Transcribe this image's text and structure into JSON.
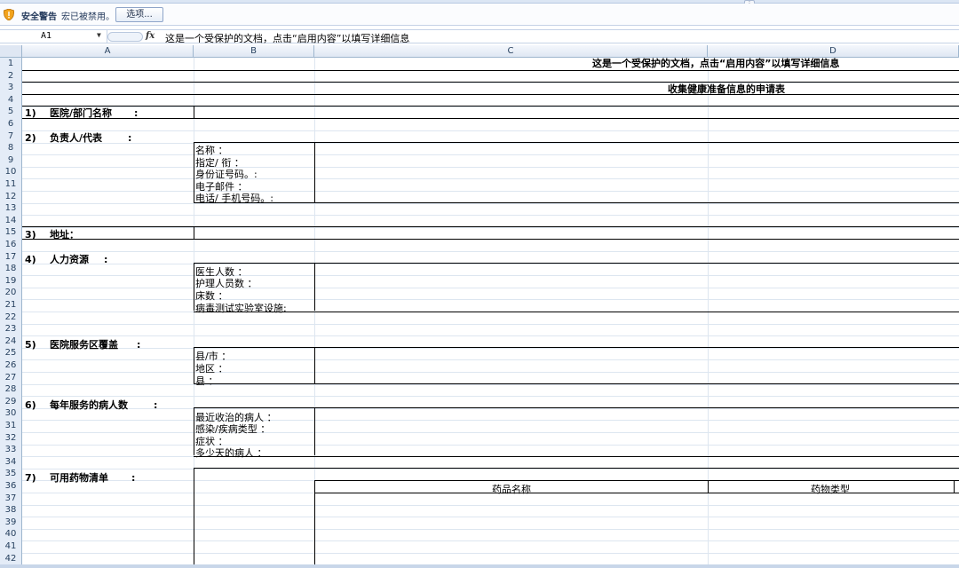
{
  "message_bar": {
    "title": "安全警告",
    "text": "宏已被禁用。",
    "options_button": "选项..."
  },
  "formula_bar": {
    "name_box": "A1",
    "fx": "fx",
    "content": "这是一个受保护的文档，点击“启用内容”以填写详细信息"
  },
  "columns": [
    "A",
    "B",
    "C",
    "D"
  ],
  "rows": [
    "1",
    "2",
    "3",
    "4",
    "5",
    "6",
    "7",
    "8",
    "9",
    "10",
    "11",
    "12",
    "13",
    "14",
    "15",
    "16",
    "17",
    "18",
    "19",
    "20",
    "21",
    "22",
    "23",
    "24",
    "25",
    "26",
    "27",
    "28",
    "29",
    "30",
    "31",
    "32",
    "33",
    "34",
    "35",
    "36",
    "37",
    "38",
    "39",
    "40",
    "41",
    "42"
  ],
  "sheet": {
    "notice": "这是一个受保护的文档，点击“启用内容”以填写详细信息",
    "form_title": "收集健康准备信息的申请表",
    "sections": [
      {
        "num": "1)",
        "label": "医院/部门名称",
        "colon": ":"
      },
      {
        "num": "2)",
        "label": "负责人/代表",
        "colon": ":"
      },
      {
        "num": "3)",
        "label": "地址：",
        "colon": ""
      },
      {
        "num": "4)",
        "label": "人力资源",
        "colon": ":"
      },
      {
        "num": "5)",
        "label": "医院服务区覆盖",
        "colon": ":"
      },
      {
        "num": "6)",
        "label": "每年服务的病人数",
        "colon": ":"
      },
      {
        "num": "7)",
        "label": "可用药物清单",
        "colon": ":"
      }
    ],
    "rep_fields": [
      "名称 ：",
      "指定/ 衔 ：",
      "身份证号码。:",
      "电子邮件  ：",
      "电话/ 手机号码。:"
    ],
    "hr_fields": [
      "医生人数  ：",
      "护理人员数  ：",
      "床数 ：",
      "病毒测试实验室设施:"
    ],
    "area_fields": [
      "县/市 ：",
      "地区 ：",
      "县 ："
    ],
    "patient_fields": [
      "最近收治的病人 ：",
      "感染/疾病类型 ：",
      "症状 ：",
      "多少天的病人 ："
    ],
    "drug_table": {
      "col1": "药品名称",
      "col2": "药物类型"
    }
  }
}
